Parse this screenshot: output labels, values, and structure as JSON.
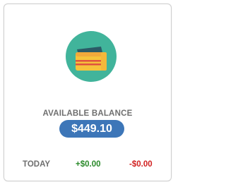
{
  "card": {
    "icon": "wallet-icon",
    "balance_label": "AVAILABLE BALANCE",
    "balance_value": "$449.10",
    "today_label": "TODAY",
    "today_credit": "+$0.00",
    "today_debit": "-$0.00"
  },
  "colors": {
    "icon_circle": "#41b49b",
    "balance_pill": "#3d76b8",
    "credit": "#2a8a2a",
    "debit": "#d12020",
    "label": "#6f6f6f"
  }
}
